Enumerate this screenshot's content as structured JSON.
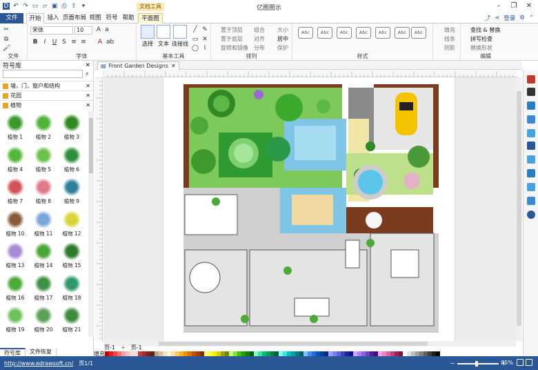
{
  "app": {
    "title": "亿图图示",
    "contextual_group": "文档工具"
  },
  "tabs": [
    {
      "label": "文件"
    },
    {
      "label": "开始"
    },
    {
      "label": "插入"
    },
    {
      "label": "页面布局"
    },
    {
      "label": "视图"
    },
    {
      "label": "符号"
    },
    {
      "label": "帮助"
    },
    {
      "label": "平面图"
    }
  ],
  "account": {
    "login_label": "登录"
  },
  "ribbon": {
    "groups": {
      "file": "文件",
      "font": "字体",
      "basic_tools": "基本工具",
      "arrange": "排列",
      "style": "样式",
      "edit": "编辑"
    },
    "font_name": "宋体",
    "font_size": "10",
    "tools": {
      "select": "选择",
      "text": "文本",
      "connector": "连接线"
    },
    "arrange_items": {
      "bring_front": "置于顶层",
      "send_back": "置于底层",
      "rotate_mirror": "旋转和镜像",
      "group": "组合",
      "align": "对齐",
      "distribute": "分布",
      "size": "大小",
      "center": "居中",
      "protect": "保护"
    },
    "style_sample": "Abc",
    "fill_items": {
      "fill": "填充",
      "line": "线条",
      "shadow": "阴影"
    },
    "edit_items": {
      "find_replace": "查找 & 替换",
      "spell_check": "拼写检查",
      "replace_shape": "替换形状"
    }
  },
  "library": {
    "title": "符号库",
    "categories": [
      {
        "label": "墙，门，窗户和结构"
      },
      {
        "label": "花园"
      },
      {
        "label": "植物"
      }
    ],
    "shapes": [
      {
        "label": "植物 1",
        "color": "#3a9a2c"
      },
      {
        "label": "植物 2",
        "color": "#4fb33a"
      },
      {
        "label": "植物 3",
        "color": "#2e8a1f"
      },
      {
        "label": "植物 4",
        "color": "#55b83c"
      },
      {
        "label": "植物 5",
        "color": "#6cc24a"
      },
      {
        "label": "植物 6",
        "color": "#2f8f3a"
      },
      {
        "label": "植物 7",
        "color": "#d0545c"
      },
      {
        "label": "植物 8",
        "color": "#e07a86"
      },
      {
        "label": "植物 9",
        "color": "#2f7f9a"
      },
      {
        "label": "植物 10",
        "color": "#8a5a3a"
      },
      {
        "label": "植物 11",
        "color": "#7aa6d9"
      },
      {
        "label": "植物 12",
        "color": "#d8d43a"
      },
      {
        "label": "植物 13",
        "color": "#a88ad6"
      },
      {
        "label": "植物 14",
        "color": "#4aa83a"
      },
      {
        "label": "植物 15",
        "color": "#2a7a2a"
      },
      {
        "label": "植物 16",
        "color": "#4caa38"
      },
      {
        "label": "植物 17",
        "color": "#3f8f45"
      },
      {
        "label": "植物 18",
        "color": "#2e9a6a"
      },
      {
        "label": "植物 19",
        "color": "#6ec25a"
      },
      {
        "label": "植物 20",
        "color": "#5ca05a"
      },
      {
        "label": "植物 21",
        "color": "#3c8c3c"
      }
    ],
    "bottom_tabs": [
      "符号库",
      "文件恢复"
    ]
  },
  "document": {
    "tab_title": "Front Garden Designs"
  },
  "pages": {
    "current": "页-1",
    "tab": "页-1"
  },
  "palette": {
    "label": "填充",
    "colors": [
      "#c00000",
      "#e02020",
      "#ff4040",
      "#ff7070",
      "#f4a0a0",
      "#f7c0c0",
      "#ffd8d8",
      "#e8e0e0",
      "#c04040",
      "#a03030",
      "#802020",
      "#602020",
      "#c0a080",
      "#d8c0a0",
      "#f0e0c0",
      "#fff0d8",
      "#ffe0a0",
      "#ffc860",
      "#ffb020",
      "#f09000",
      "#e07000",
      "#c05000",
      "#a04000",
      "#803000",
      "#ffff80",
      "#ffff40",
      "#f0f000",
      "#d0d000",
      "#a0a000",
      "#808000",
      "#c0ff80",
      "#80e040",
      "#40c000",
      "#20a000",
      "#108000",
      "#006000",
      "#80ffc0",
      "#40e0a0",
      "#00c080",
      "#00a060",
      "#008040",
      "#006030",
      "#80ffff",
      "#40e0e0",
      "#00c0c0",
      "#00a0a0",
      "#008080",
      "#006060",
      "#80c0ff",
      "#4090f0",
      "#2070e0",
      "#1050c0",
      "#0040a0",
      "#003080",
      "#a0a0ff",
      "#8080f0",
      "#6060e0",
      "#4040c0",
      "#2020a0",
      "#101080",
      "#d0a0ff",
      "#b080f0",
      "#9060e0",
      "#7040c0",
      "#5020a0",
      "#401080",
      "#ffa0e0",
      "#f080c0",
      "#e060a0",
      "#c04080",
      "#a02060",
      "#801040",
      "#ffffff",
      "#e0e0e0",
      "#c0c0c0",
      "#a0a0a0",
      "#808080",
      "#606060",
      "#404040",
      "#202020",
      "#000000"
    ]
  },
  "status": {
    "url": "http://www.edrawsoft.cn/",
    "page": "页1/1",
    "zoom": "85%"
  },
  "icons": {
    "undo": "undo-icon",
    "redo": "redo-icon",
    "save": "save-icon",
    "print": "print-icon",
    "close": "close-icon",
    "search": "search-icon",
    "share": "share-icon",
    "gear": "gear-icon"
  }
}
